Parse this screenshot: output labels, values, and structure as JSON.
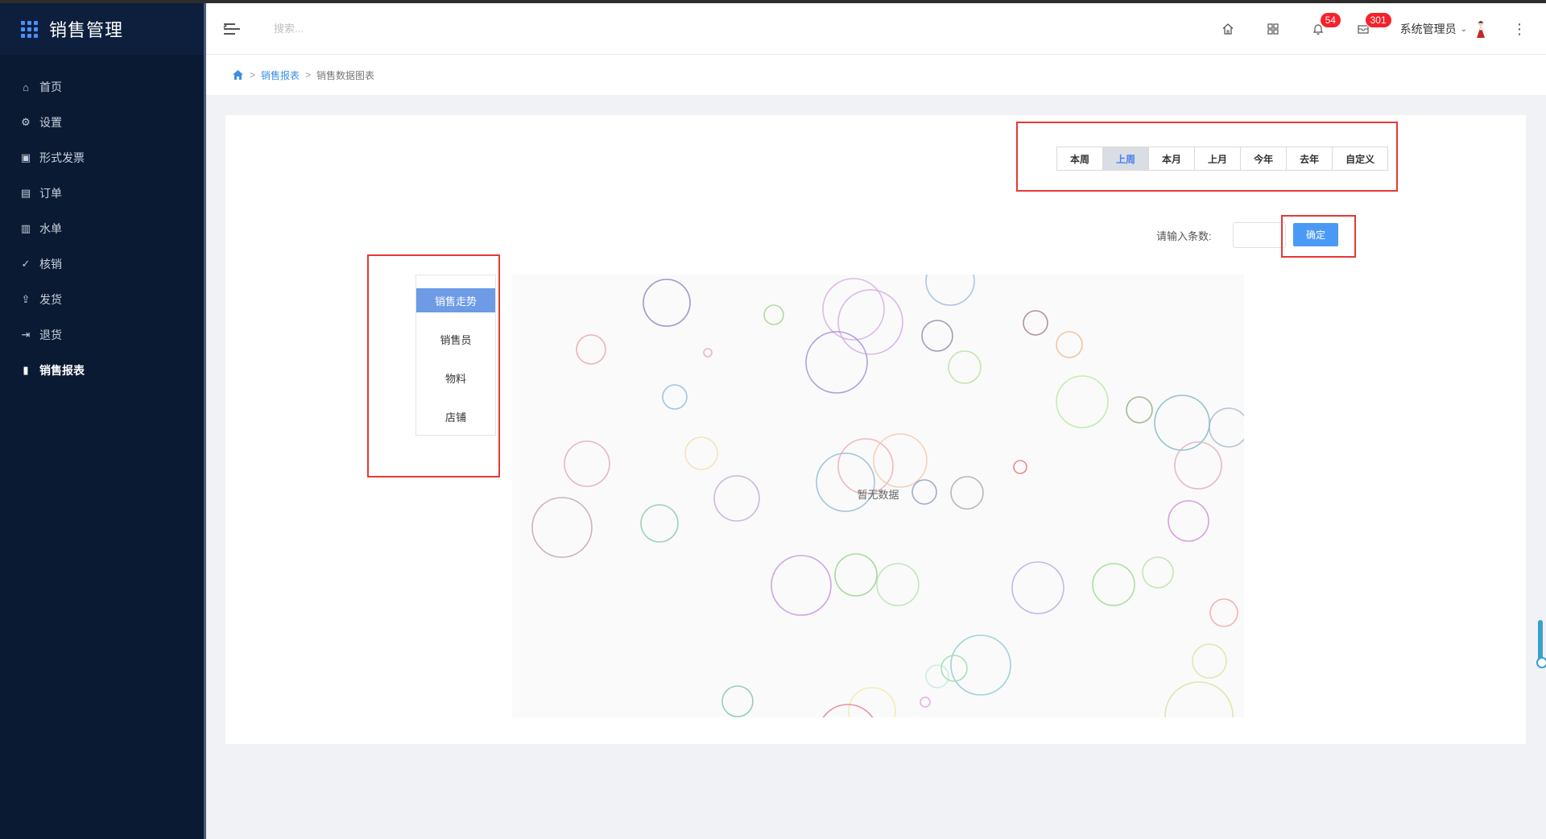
{
  "app": {
    "title": "销售管理"
  },
  "sidebar": {
    "items": [
      {
        "label": "首页",
        "icon": "home-icon",
        "glyph": "⌂"
      },
      {
        "label": "设置",
        "icon": "gear-icon",
        "glyph": "⚙"
      },
      {
        "label": "形式发票",
        "icon": "invoice-icon",
        "glyph": "▣"
      },
      {
        "label": "订单",
        "icon": "order-icon",
        "glyph": "▤"
      },
      {
        "label": "水单",
        "icon": "receipt-icon",
        "glyph": "▥"
      },
      {
        "label": "核销",
        "icon": "check-circle-icon",
        "glyph": "✓"
      },
      {
        "label": "发货",
        "icon": "upload-icon",
        "glyph": "⇪"
      },
      {
        "label": "退货",
        "icon": "return-icon",
        "glyph": "⇥"
      },
      {
        "label": "销售报表",
        "icon": "bar-chart-icon",
        "glyph": "▮"
      }
    ],
    "active_index": 8
  },
  "header": {
    "search_placeholder": "搜索...",
    "notifications_badge": "54",
    "messages_badge": "301",
    "user_name": "系统管理员"
  },
  "breadcrumb": {
    "items": [
      "销售报表",
      "销售数据图表"
    ],
    "separator": ">"
  },
  "period_tabs": {
    "items": [
      "本周",
      "上周",
      "本月",
      "上月",
      "今年",
      "去年",
      "自定义"
    ],
    "active_index": 1
  },
  "count_filter": {
    "label": "请输入条数:",
    "input_value": "",
    "confirm_label": "确定"
  },
  "report_tabs": {
    "items": [
      "销售走势",
      "销售员",
      "物料",
      "店铺"
    ],
    "active_index": 0
  },
  "chart": {
    "empty_text": "暂无数据"
  },
  "colors": {
    "sidebar_bg": "#0a1a33",
    "accent": "#4a9af5",
    "badge": "#f5222d",
    "highlight_box": "#e53935"
  }
}
